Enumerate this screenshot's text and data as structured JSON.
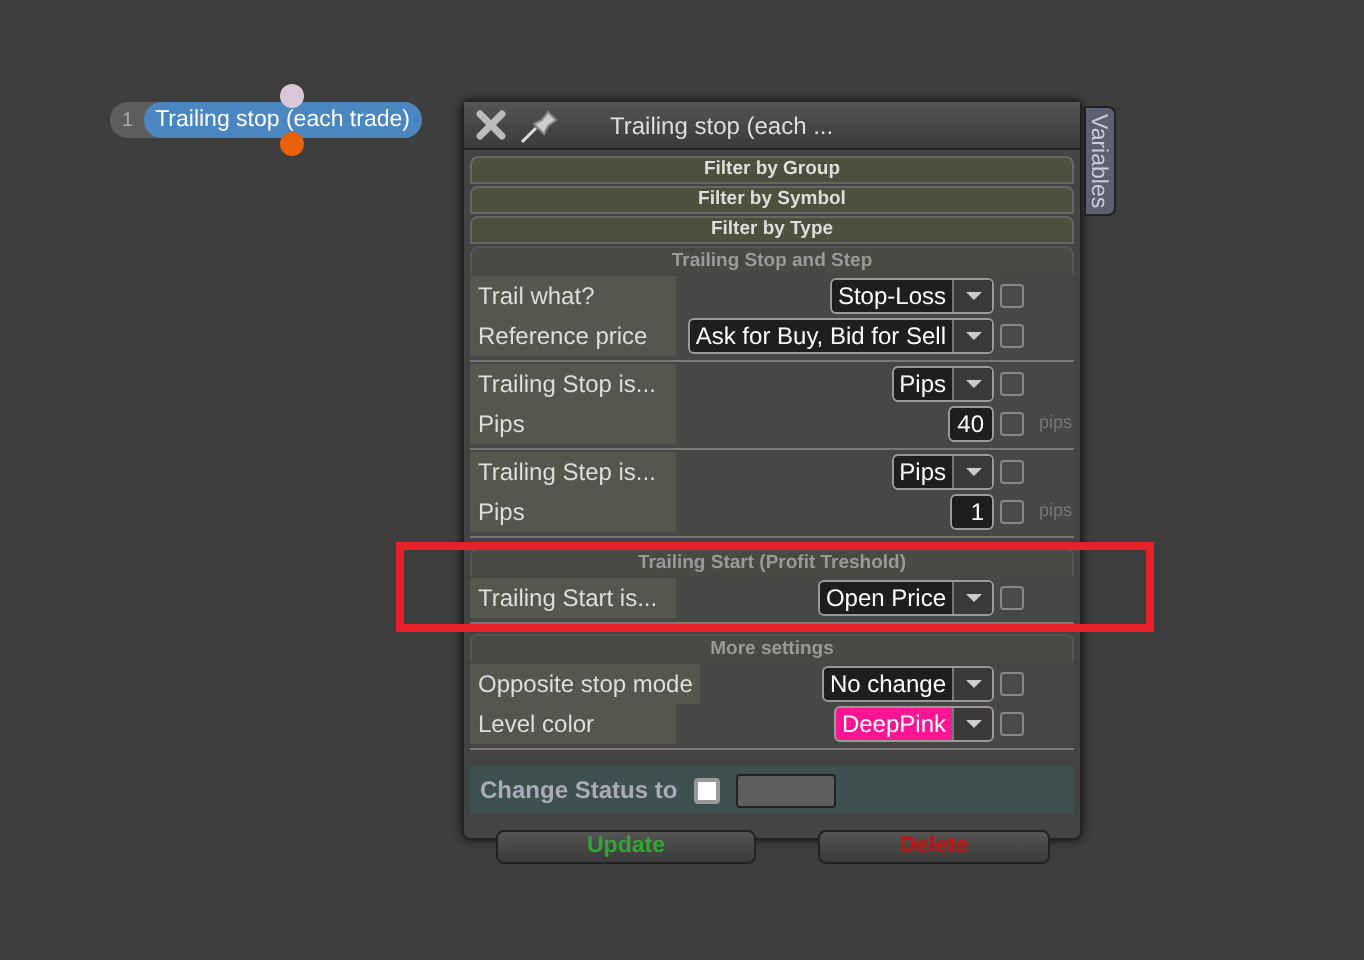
{
  "node": {
    "index": "1",
    "label": "Trailing stop (each trade)"
  },
  "window": {
    "title": "Trailing stop (each ...",
    "side_tab": "Variables"
  },
  "filters": [
    {
      "label": "Filter by Group"
    },
    {
      "label": "Filter by Symbol"
    },
    {
      "label": "Filter by Type"
    }
  ],
  "sections": [
    {
      "title": "Trailing Stop and Step",
      "highlighted": false,
      "groups": [
        [
          {
            "label": "Trail what?",
            "kind": "select",
            "value": "Stop-Loss",
            "checked": false
          },
          {
            "label": "Reference price",
            "kind": "select",
            "value": "Ask for Buy, Bid for Sell",
            "checked": false
          }
        ],
        [
          {
            "label": "Trailing Stop is...",
            "kind": "select",
            "value": "Pips",
            "checked": false
          },
          {
            "label": "Pips",
            "kind": "number",
            "value": "40",
            "unit": "pips",
            "checked": false
          }
        ],
        [
          {
            "label": "Trailing Step is...",
            "kind": "select",
            "value": "Pips",
            "checked": false
          },
          {
            "label": "Pips",
            "kind": "number",
            "value": "1",
            "unit": "pips",
            "checked": false
          }
        ]
      ]
    },
    {
      "title": "Trailing Start (Profit Treshold)",
      "highlighted": true,
      "groups": [
        [
          {
            "label": "Trailing Start is...",
            "kind": "select",
            "value": "Open Price",
            "checked": false
          }
        ]
      ]
    },
    {
      "title": "More settings",
      "highlighted": false,
      "groups": [
        [
          {
            "label": "Opposite stop mode",
            "kind": "select",
            "value": "No change",
            "checked": false
          },
          {
            "label": "Level color",
            "kind": "select",
            "value": "DeepPink",
            "color": "#ff1493",
            "checked": false
          }
        ]
      ]
    }
  ],
  "status": {
    "label": "Change Status to",
    "checked": false
  },
  "buttons": [
    {
      "label": "Update",
      "kind": "update"
    },
    {
      "label": "Delete",
      "kind": "delete"
    }
  ]
}
